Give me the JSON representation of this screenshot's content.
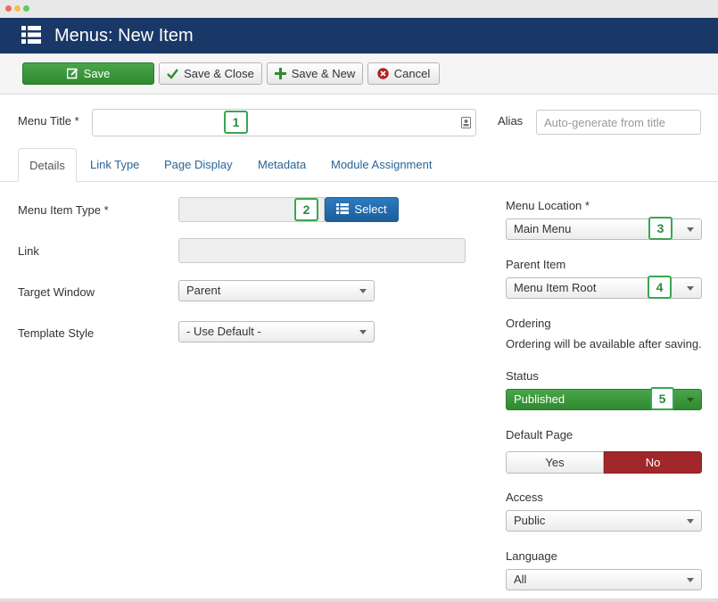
{
  "header": {
    "title": "Menus: New Item",
    "icon": "list-icon"
  },
  "toolbar": {
    "save": "Save",
    "save_close": "Save & Close",
    "save_new": "Save & New",
    "cancel": "Cancel"
  },
  "form": {
    "menu_title_label": "Menu Title *",
    "menu_title_value": "",
    "alias_label": "Alias",
    "alias_placeholder": "Auto-generate from title"
  },
  "tabs": [
    "Details",
    "Link Type",
    "Page Display",
    "Metadata",
    "Module Assignment"
  ],
  "details": {
    "menu_item_type_label": "Menu Item Type *",
    "select_button": "Select",
    "link_label": "Link",
    "target_window_label": "Target Window",
    "target_window_value": "Parent",
    "template_style_label": "Template Style",
    "template_style_value": "- Use Default -"
  },
  "sidebar": {
    "menu_location_label": "Menu Location *",
    "menu_location_value": "Main Menu",
    "parent_item_label": "Parent Item",
    "parent_item_value": "Menu Item Root",
    "ordering_label": "Ordering",
    "ordering_note": "Ordering will be available after saving.",
    "status_label": "Status",
    "status_value": "Published",
    "default_page_label": "Default Page",
    "default_yes": "Yes",
    "default_no": "No",
    "access_label": "Access",
    "access_value": "Public",
    "language_label": "Language",
    "language_value": "All"
  },
  "callouts": [
    "1",
    "2",
    "3",
    "4",
    "5"
  ],
  "colors": {
    "header_bg": "#1a3867",
    "save_green": "#3c9a3c",
    "select_blue": "#2370b3",
    "no_red": "#a0282a",
    "callout_green": "#3aa552"
  }
}
